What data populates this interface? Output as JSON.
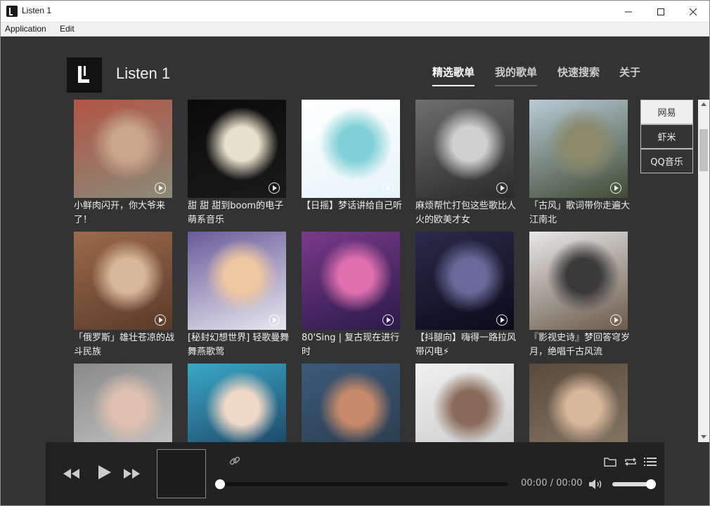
{
  "window": {
    "title": "Listen 1"
  },
  "menu": {
    "items": [
      "Application",
      "Edit"
    ]
  },
  "header": {
    "app_name": "Listen 1"
  },
  "nav": {
    "tabs": [
      {
        "label": "精选歌单",
        "state": "active"
      },
      {
        "label": "我的歌单",
        "state": "hover"
      },
      {
        "label": "快速搜索",
        "state": "normal"
      },
      {
        "label": "关于",
        "state": "normal"
      }
    ]
  },
  "sources": [
    {
      "label": "网易",
      "active": true
    },
    {
      "label": "虾米",
      "active": false
    },
    {
      "label": "QQ音乐",
      "active": false
    }
  ],
  "playlists": [
    {
      "title": "小鲜肉闪开，你大爷来了！",
      "colors": [
        "#b25545",
        "#c9a58a",
        "#8a8a78"
      ]
    },
    {
      "title": "甜 甜 甜到boom的电子萌系音乐",
      "colors": [
        "#0a0a0a",
        "#e8e0cc",
        "#1a1a1a"
      ]
    },
    {
      "title": "【日摇】梦话讲给自己听",
      "colors": [
        "#ffffff",
        "#7fd0d8",
        "#e6f4f7"
      ]
    },
    {
      "title": "麻烦帮忙打包这些歌比人火的欧美才女",
      "colors": [
        "#6e6e6e",
        "#d0d0d0",
        "#2a2a2a"
      ]
    },
    {
      "title": "「古风」歌词带你走遍大江南北",
      "colors": [
        "#b9cbd6",
        "#8a8a6a",
        "#3f4a32"
      ]
    },
    {
      "title": "「俄罗斯」雄壮苍凉的战斗民族",
      "colors": [
        "#9b6a4a",
        "#d8b89a",
        "#5a3a2a"
      ]
    },
    {
      "title": "[秘封幻想世界] 轻歌曼舞 舞燕歌莺",
      "colors": [
        "#6a5a9a",
        "#f0c8a0",
        "#e8e8f0"
      ]
    },
    {
      "title": "80'Sing | 复古现在进行时",
      "colors": [
        "#7a3a8a",
        "#e070b0",
        "#2a1a4a"
      ]
    },
    {
      "title": "【抖腿向】嗨得一路拉风带闪电⚡",
      "colors": [
        "#2a2a4a",
        "#6a6a9a",
        "#0a0a1a"
      ]
    },
    {
      "title": "『影视史诗』梦回答穹岁月，绝唱千古风流",
      "colors": [
        "#e8e8e8",
        "#3a3a3a",
        "#6a5a4a"
      ]
    },
    {
      "title": "",
      "colors": [
        "#8a8a8a",
        "#e0c0b0",
        "#c8c8c8"
      ]
    },
    {
      "title": "",
      "colors": [
        "#3aa8c8",
        "#f0d8c8",
        "#1a3a5a"
      ]
    },
    {
      "title": "",
      "colors": [
        "#3a5a7a",
        "#c88a6a",
        "#2a3a4a"
      ]
    },
    {
      "title": "",
      "colors": [
        "#f0f0f0",
        "#8a6a5a",
        "#c8c8c8"
      ]
    },
    {
      "title": "",
      "colors": [
        "#5a4a3a",
        "#d8b89a",
        "#8a7a6a"
      ]
    }
  ],
  "player": {
    "time": "00:00 / 00:00",
    "progress": 0,
    "volume": 0.95,
    "icons": [
      "prev-icon",
      "play-icon",
      "next-icon",
      "link-icon",
      "folder-icon",
      "repeat-icon",
      "playlist-icon",
      "volume-icon"
    ]
  }
}
